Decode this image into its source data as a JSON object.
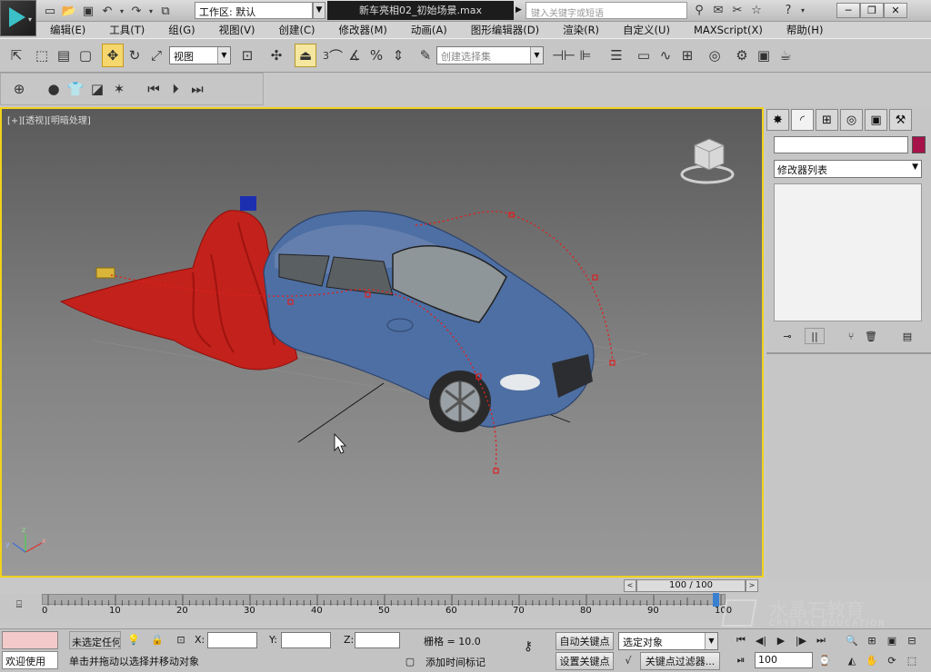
{
  "titlebar": {
    "workspace_label": "工作区: 默认",
    "file_title": "新车亮相02_初始场景.max",
    "search_placeholder": "键入关键字或短语"
  },
  "menu": [
    "编辑(E)",
    "工具(T)",
    "组(G)",
    "视图(V)",
    "创建(C)",
    "修改器(M)",
    "动画(A)",
    "图形编辑器(D)",
    "渲染(R)",
    "自定义(U)",
    "MAXScript(X)",
    "帮助(H)"
  ],
  "toolbar": {
    "ref_coord": "视图",
    "snap_value": "3",
    "selection_set_placeholder": "创建选择集"
  },
  "viewport": {
    "label": "[+][透视][明暗处理]"
  },
  "command_panel": {
    "modifier_list": "修改器列表"
  },
  "timeline": {
    "frame_counter": "100 / 100",
    "ticks": [
      "0",
      "10",
      "20",
      "30",
      "40",
      "50",
      "60",
      "70",
      "80",
      "90",
      "100"
    ]
  },
  "status": {
    "welcome": "欢迎使用",
    "selection": "未选定任何对象",
    "prompt": "单击并拖动以选择并移动对象",
    "x_label": "X:",
    "y_label": "Y:",
    "z_label": "Z:",
    "grid": "栅格 = 10.0",
    "add_time_tag": "添加时间标记",
    "auto_key": "自动关键点",
    "set_key": "设置关键点",
    "selected_object": "选定对象",
    "key_filters": "关键点过滤器...",
    "frame_value": "100"
  },
  "watermark": {
    "cn": "水晶石教育",
    "en": "CRYSTAL EDUCATION"
  }
}
